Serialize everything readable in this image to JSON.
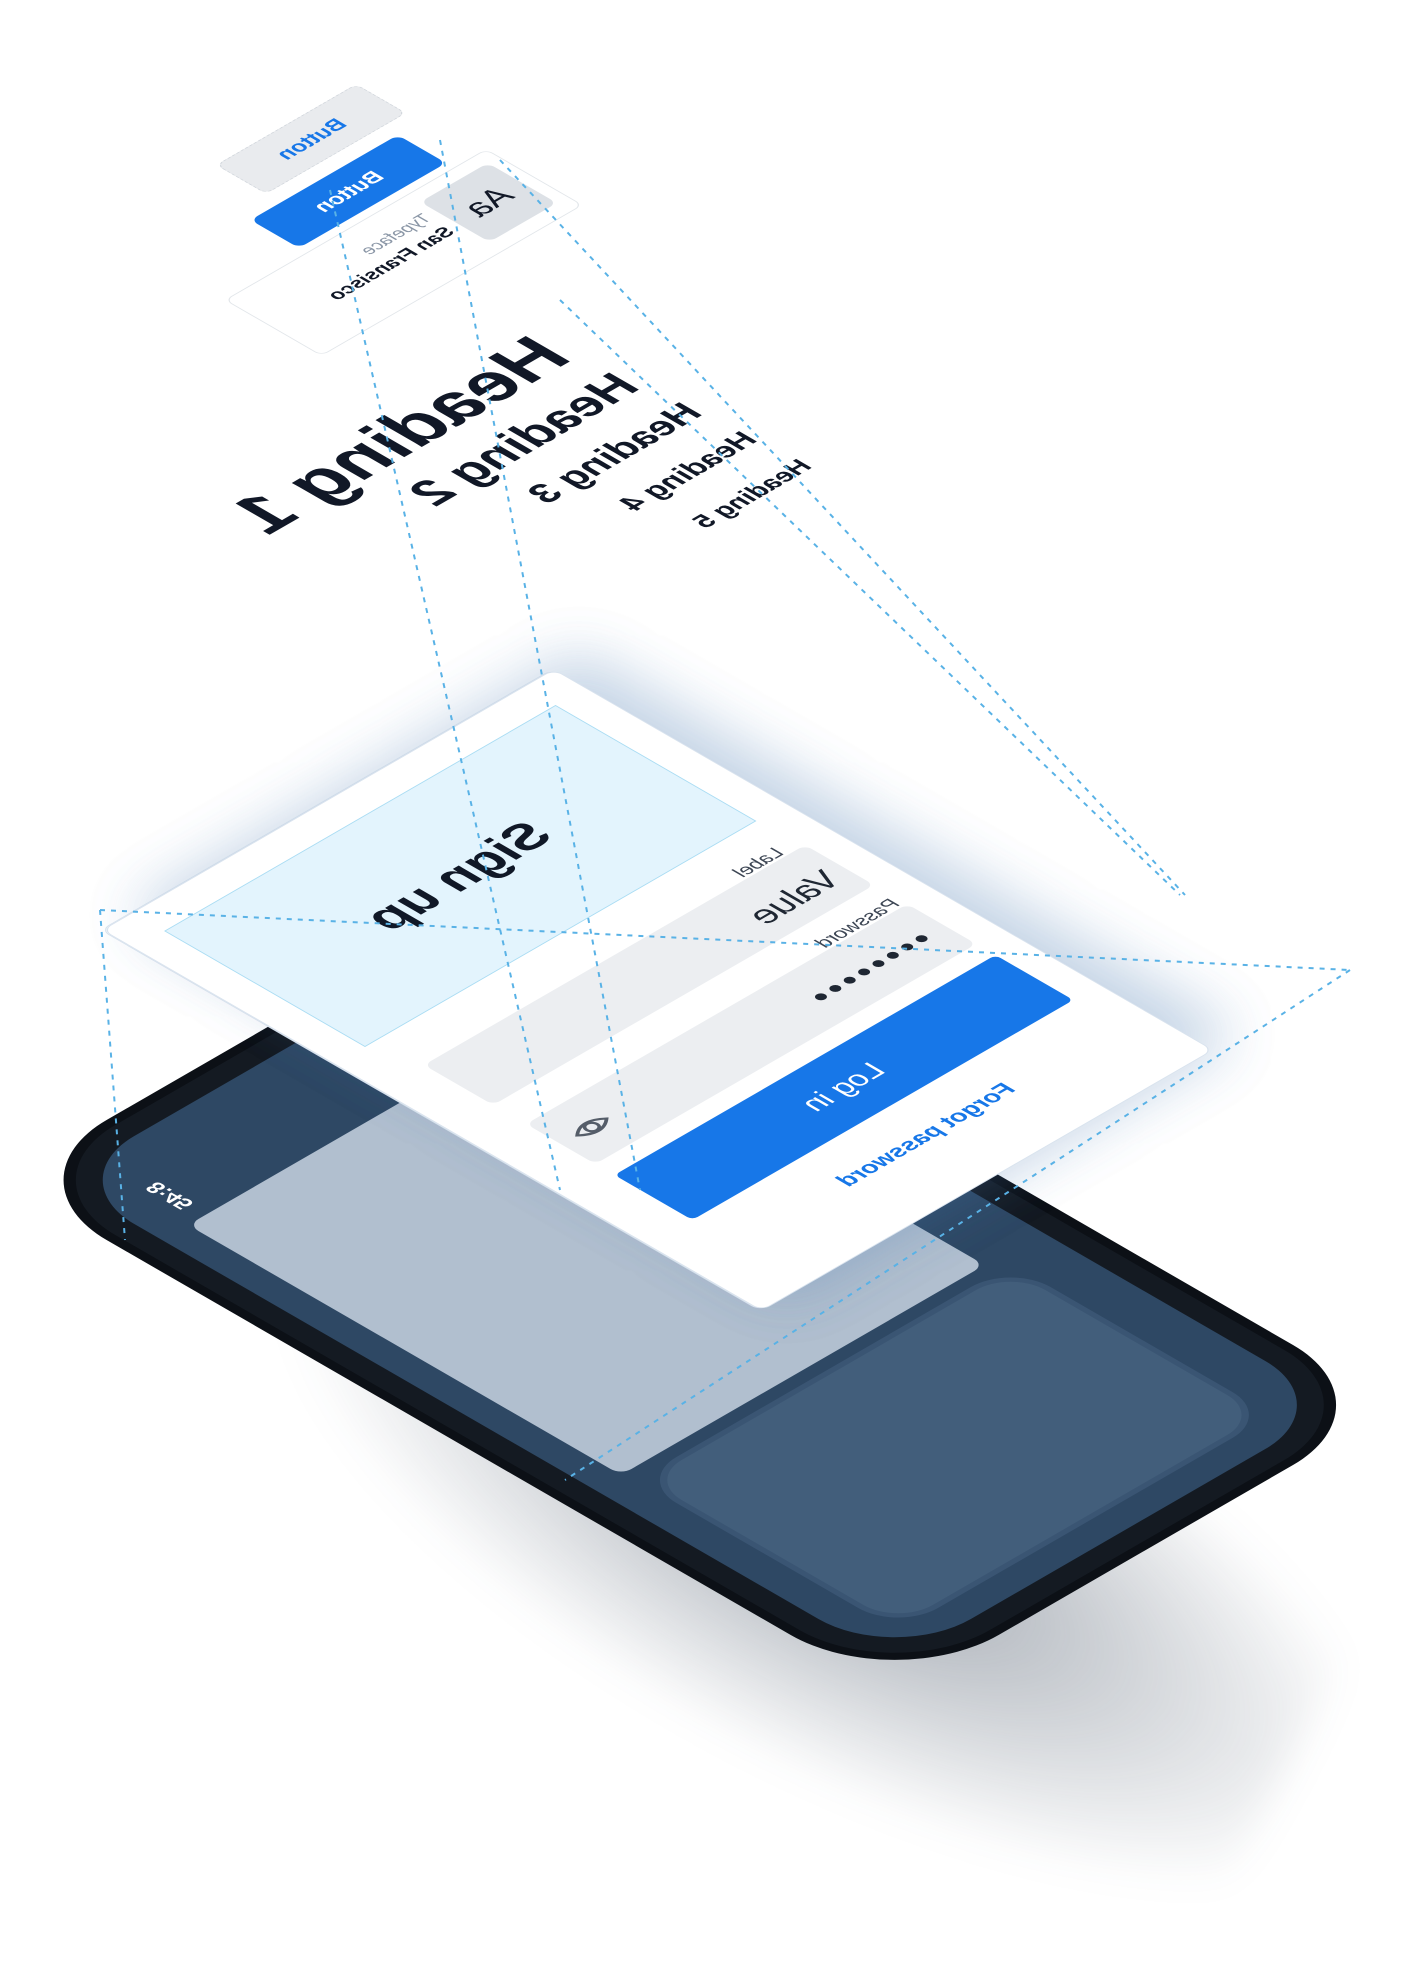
{
  "phone": {
    "status_time": "8:45"
  },
  "form": {
    "title": "Sign up",
    "label_field": "Label",
    "value_field": "Value",
    "password_label": "Password",
    "password_mask": "••••••••",
    "eye_icon": "eye-icon",
    "login_label": "Log in",
    "forgot_label": "Forgot password"
  },
  "typography": {
    "h1": "Heading 1",
    "h2": "Heading 2",
    "h3": "Heading 3",
    "h4": "Heading 4",
    "h5": "Heading 5"
  },
  "components": {
    "primary_button": "Button",
    "secondary_button": "Button",
    "typeface_label": "Typeface",
    "typeface_value": "San Fransisco",
    "sample_glyph": "Aa"
  },
  "colors": {
    "accent": "#1777e8",
    "title_band": "#e3f4fd",
    "phone_screen": "#2e4864",
    "guide_line": "#59b2e6"
  }
}
